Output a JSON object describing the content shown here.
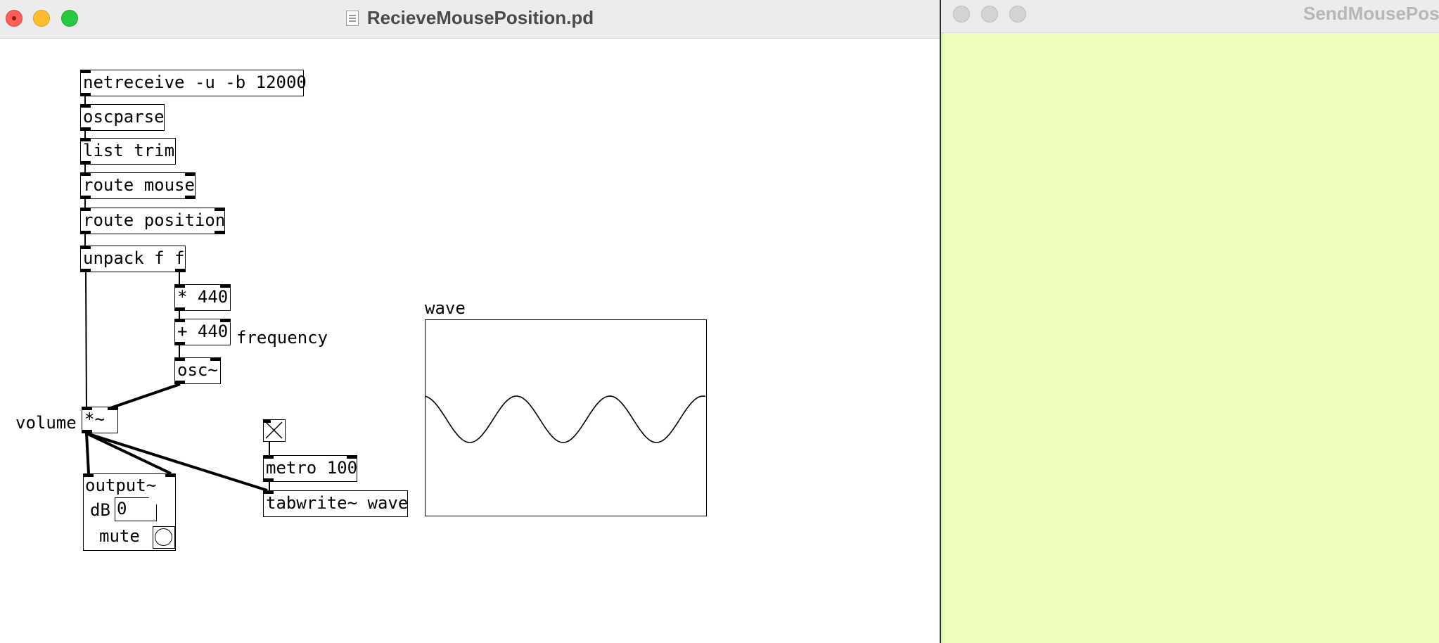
{
  "main_window": {
    "title": "RecieveMousePosition.pd",
    "objects": {
      "netreceive": "netreceive -u -b 12000",
      "oscparse": "oscparse",
      "list_trim": "list trim",
      "route_mouse": "route mouse",
      "route_position": "route position",
      "unpack": "unpack f f",
      "mult440": "* 440",
      "add440": "+ 440",
      "osc": "osc~",
      "mult_sig": "*~",
      "metro": "metro 100",
      "tabwrite": "tabwrite~ wave"
    },
    "comments": {
      "frequency": "frequency",
      "volume": "volume"
    },
    "output_abstraction": {
      "title": "output~",
      "db_label": "dB",
      "db_value": "0",
      "mute_label": "mute"
    },
    "toggle": {
      "checked": true
    },
    "array": {
      "name": "wave",
      "cycles_shown": 3
    }
  },
  "second_window": {
    "title": "SendMousePosition.pd",
    "background": "#eefebf"
  },
  "colors": {
    "close": "#ff5f57",
    "minimize": "#febc2e",
    "maximize": "#28c840"
  }
}
